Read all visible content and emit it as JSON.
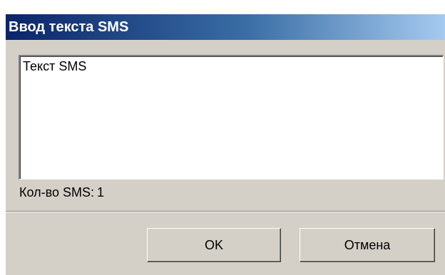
{
  "window": {
    "title": "Ввод текста SMS"
  },
  "message": {
    "value": "Текст SMS"
  },
  "sms_count": {
    "label": "Кол-во SMS:",
    "value": "1"
  },
  "buttons": {
    "ok_label": "OK",
    "cancel_label": "Отмена"
  },
  "colors": {
    "title_gradient_start": "#0a246a",
    "title_gradient_end": "#a6caf0",
    "dialog_face": "#d4d0c8"
  }
}
